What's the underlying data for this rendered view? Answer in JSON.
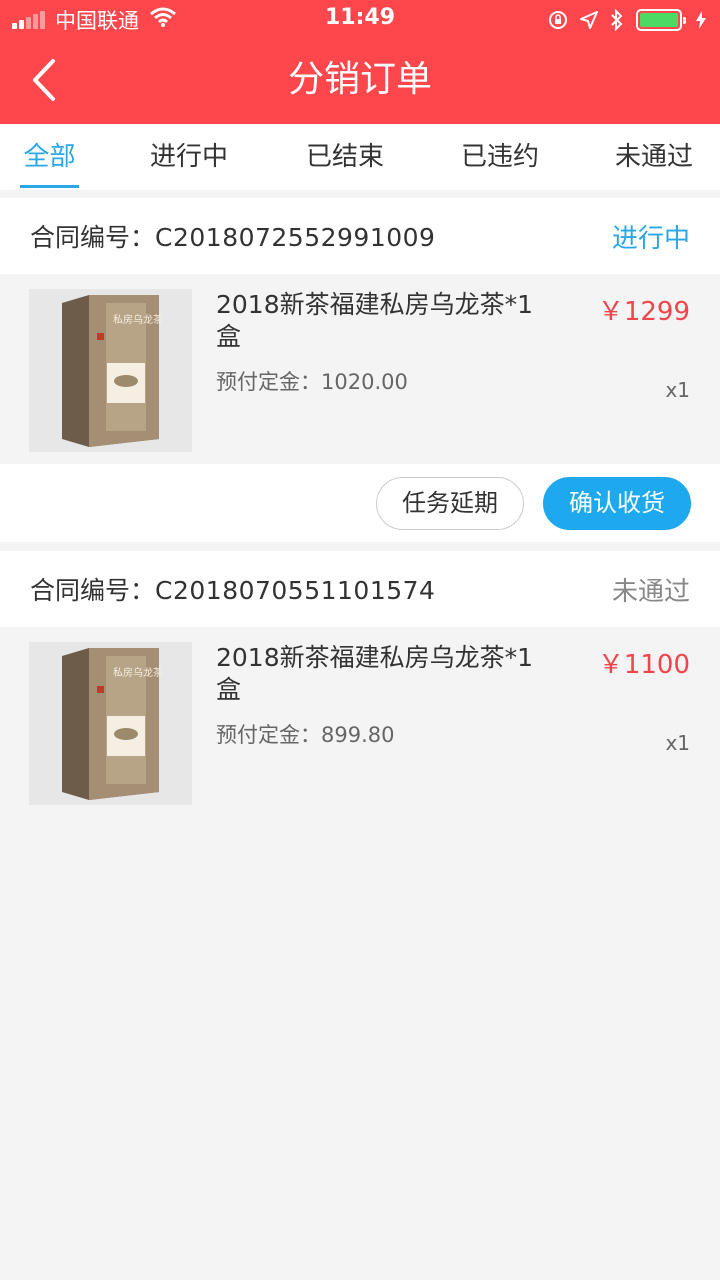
{
  "status_bar": {
    "carrier": "中国联通",
    "time": "11:49"
  },
  "header": {
    "title": "分销订单"
  },
  "tabs": [
    {
      "label": "全部",
      "active": true
    },
    {
      "label": "进行中",
      "active": false
    },
    {
      "label": "已结束",
      "active": false
    },
    {
      "label": "已违约",
      "active": false
    },
    {
      "label": "未通过",
      "active": false
    }
  ],
  "orders": [
    {
      "contract_label": "合同编号：",
      "contract_no": "C2018072552991009",
      "status": "进行中",
      "status_color": "#2aa7e6",
      "product_name": "2018新茶福建私房乌龙茶*1盒",
      "deposit_label": "预付定金：",
      "deposit": "1020.00",
      "price": "￥1299",
      "qty": "x1",
      "actions": {
        "delay": "任务延期",
        "confirm": "确认收货"
      }
    },
    {
      "contract_label": "合同编号：",
      "contract_no": "C2018070551101574",
      "status": "未通过",
      "status_color": "#888888",
      "product_name": "2018新茶福建私房乌龙茶*1盒",
      "deposit_label": "预付定金：",
      "deposit": "899.80",
      "price": "￥1100",
      "qty": "x1"
    }
  ],
  "colors": {
    "header": "#fd474c",
    "accent": "#2aa7e6",
    "price": "#f0454c",
    "button_primary": "#1ea9ef"
  }
}
